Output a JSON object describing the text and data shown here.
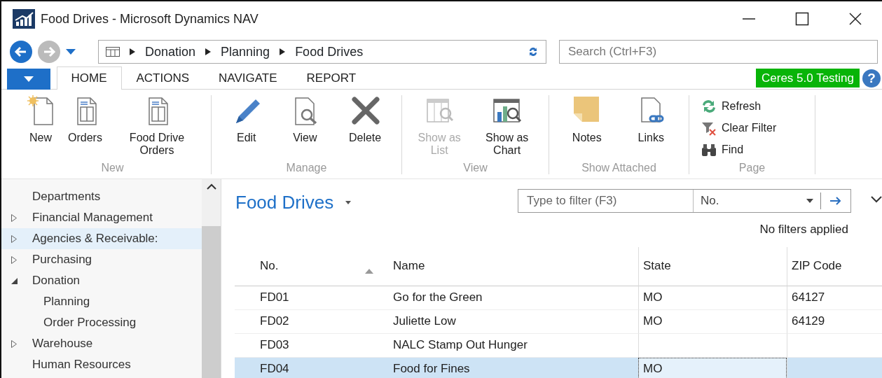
{
  "window": {
    "title": "Food Drives - Microsoft Dynamics NAV"
  },
  "address_bar": {
    "breadcrumb": [
      "Donation",
      "Planning",
      "Food Drives"
    ],
    "search": {
      "placeholder": "Search (Ctrl+F3)"
    }
  },
  "ribbon": {
    "tabs": [
      {
        "label": "HOME",
        "selected": true
      },
      {
        "label": "ACTIONS",
        "selected": false
      },
      {
        "label": "NAVIGATE",
        "selected": false
      },
      {
        "label": "REPORT",
        "selected": false
      }
    ],
    "environment": "Ceres 5.0 Testing",
    "groups": [
      {
        "label": "New",
        "actions": [
          {
            "kind": "large",
            "label": "New",
            "disabled": false
          },
          {
            "kind": "large",
            "label": "Orders",
            "disabled": false
          },
          {
            "kind": "large",
            "label": "Food Drive Orders",
            "disabled": false
          }
        ]
      },
      {
        "label": "Manage",
        "actions": [
          {
            "kind": "large",
            "label": "Edit",
            "disabled": false
          },
          {
            "kind": "large",
            "label": "View",
            "disabled": false
          },
          {
            "kind": "large",
            "label": "Delete",
            "disabled": false
          }
        ]
      },
      {
        "label": "View",
        "actions": [
          {
            "kind": "large",
            "label": "Show as List",
            "disabled": true
          },
          {
            "kind": "large",
            "label": "Show as Chart",
            "disabled": false
          }
        ]
      },
      {
        "label": "Show Attached",
        "actions": [
          {
            "kind": "large",
            "label": "Notes",
            "disabled": false
          },
          {
            "kind": "large",
            "label": "Links",
            "disabled": false
          }
        ]
      },
      {
        "label": "Page",
        "actions": [
          {
            "kind": "small",
            "label": "Refresh",
            "disabled": false
          },
          {
            "kind": "small",
            "label": "Clear Filter",
            "disabled": false
          },
          {
            "kind": "small",
            "label": "Find",
            "disabled": false
          }
        ]
      }
    ],
    "help": "?"
  },
  "sidebar": {
    "items": [
      {
        "label": "Departments",
        "selected": false
      },
      {
        "label": "Financial Management",
        "expanded": false,
        "selected": false
      },
      {
        "label": "Agencies & Receivable:",
        "expanded": false,
        "selected": true
      },
      {
        "label": "Purchasing",
        "expanded": false,
        "selected": false
      },
      {
        "label": "Donation",
        "expanded": true,
        "selected": false,
        "children": [
          {
            "label": "Planning",
            "selected": false
          },
          {
            "label": "Order Processing",
            "selected": false
          }
        ]
      },
      {
        "label": "Warehouse",
        "expanded": false,
        "selected": false
      },
      {
        "label": "Human Resources",
        "selected": false
      }
    ]
  },
  "page": {
    "title": "Food Drives",
    "filter": {
      "placeholder": "Type to filter (F3)",
      "field": "No."
    },
    "filter_status": "No filters applied",
    "table": {
      "columns": [
        {
          "label": "No.",
          "sorted": true
        },
        {
          "label": "Name",
          "sorted": false
        },
        {
          "label": "State",
          "sorted": false
        },
        {
          "label": "ZIP Code",
          "sorted": false
        }
      ],
      "rows": [
        {
          "no": "FD01",
          "name": "Go for the Green",
          "state": "MO",
          "zip_code": "64127",
          "selected": false
        },
        {
          "no": "FD02",
          "name": "Juliette Low",
          "state": "MO",
          "zip_code": "64129",
          "selected": false
        },
        {
          "no": "FD03",
          "name": "NALC Stamp Out Hunger",
          "selected": false
        },
        {
          "no": "FD04",
          "name": "Food for Fines",
          "state": "MO",
          "selected": true
        }
      ]
    }
  }
}
